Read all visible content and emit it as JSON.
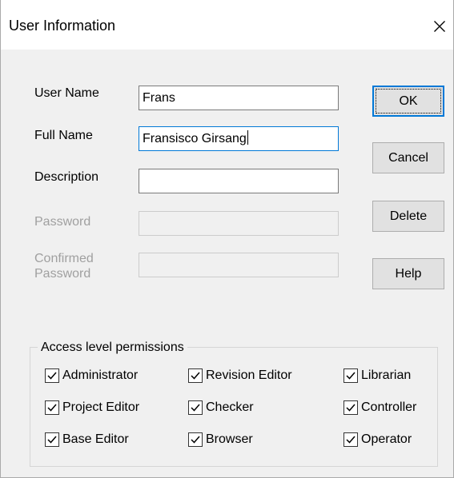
{
  "window": {
    "title": "User Information"
  },
  "form": {
    "user_name_label": "User Name",
    "user_name_value": "Frans",
    "full_name_label": "Full Name",
    "full_name_value": "Fransisco Girsang",
    "description_label": "Description",
    "description_value": "",
    "password_label": "Password",
    "confirmed_password_label_line1": "Confirmed",
    "confirmed_password_label_line2": "Password"
  },
  "buttons": {
    "ok": "OK",
    "cancel": "Cancel",
    "delete": "Delete",
    "help": "Help"
  },
  "permissions": {
    "title": "Access level permissions",
    "items": [
      {
        "label": "Administrator",
        "checked": true
      },
      {
        "label": "Revision Editor",
        "checked": true
      },
      {
        "label": "Librarian",
        "checked": true
      },
      {
        "label": "Project Editor",
        "checked": true
      },
      {
        "label": "Checker",
        "checked": true
      },
      {
        "label": "Controller",
        "checked": true
      },
      {
        "label": "Base Editor",
        "checked": true
      },
      {
        "label": "Browser",
        "checked": true
      },
      {
        "label": "Operator",
        "checked": true
      }
    ]
  },
  "colors": {
    "focus_accent": "#0078d7",
    "dialog_bg": "#f0f0f0",
    "disabled_text": "#a0a0a0"
  },
  "icons": {
    "close": "close-icon",
    "check": "checkmark-icon"
  }
}
